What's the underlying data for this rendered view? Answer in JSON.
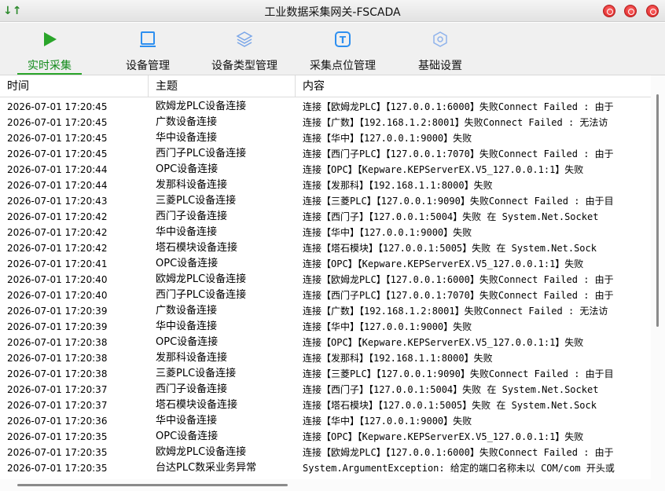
{
  "window": {
    "title": "工业数据采集网关-FSCADA",
    "app_icon": "sort-arrows-icon",
    "buttons": [
      "minimize",
      "maximize",
      "close"
    ],
    "button_color": "#e02424"
  },
  "toolbar": {
    "accent": "#2aa52a",
    "items": [
      {
        "label": "实时采集",
        "icon": "play-icon",
        "active": true
      },
      {
        "label": "设备管理",
        "icon": "monitor-icon",
        "active": false
      },
      {
        "label": "设备类型管理",
        "icon": "layers-icon",
        "active": false
      },
      {
        "label": "采集点位管理",
        "icon": "tag-icon",
        "active": false
      },
      {
        "label": "基础设置",
        "icon": "settings-icon",
        "active": false
      }
    ]
  },
  "grid": {
    "columns": [
      "时间",
      "主题",
      "内容"
    ],
    "rows": [
      [
        "2026-07-01 17:20:45",
        "欧姆龙PLC设备连接",
        "连接【欧姆龙PLC】【127.0.0.1:6000】失败Connect Failed : 由于"
      ],
      [
        "2026-07-01 17:20:45",
        "广数设备连接",
        "连接【广数】【192.168.1.2:8001】失败Connect Failed : 无法访"
      ],
      [
        "2026-07-01 17:20:45",
        "华中设备连接",
        "连接【华中】【127.0.0.1:9000】失败"
      ],
      [
        "2026-07-01 17:20:45",
        "西门子PLC设备连接",
        "连接【西门子PLC】【127.0.0.1:7070】失败Connect Failed : 由于"
      ],
      [
        "2026-07-01 17:20:44",
        "OPC设备连接",
        "连接【OPC】【Kepware.KEPServerEX.V5_127.0.0.1:1】失败"
      ],
      [
        "2026-07-01 17:20:44",
        "发那科设备连接",
        "连接【发那科】【192.168.1.1:8000】失败"
      ],
      [
        "2026-07-01 17:20:43",
        "三菱PLC设备连接",
        "连接【三菱PLC】【127.0.0.1:9090】失败Connect Failed : 由于目"
      ],
      [
        "2026-07-01 17:20:42",
        "西门子设备连接",
        "连接【西门子】【127.0.0.1:5004】失败   在 System.Net.Socket"
      ],
      [
        "2026-07-01 17:20:42",
        "华中设备连接",
        "连接【华中】【127.0.0.1:9000】失败"
      ],
      [
        "2026-07-01 17:20:42",
        "塔石模块设备连接",
        "连接【塔石模块】【127.0.0.1:5005】失败   在 System.Net.Sock"
      ],
      [
        "2026-07-01 17:20:41",
        "OPC设备连接",
        "连接【OPC】【Kepware.KEPServerEX.V5_127.0.0.1:1】失败"
      ],
      [
        "2026-07-01 17:20:40",
        "欧姆龙PLC设备连接",
        "连接【欧姆龙PLC】【127.0.0.1:6000】失败Connect Failed : 由于"
      ],
      [
        "2026-07-01 17:20:40",
        "西门子PLC设备连接",
        "连接【西门子PLC】【127.0.0.1:7070】失败Connect Failed : 由于"
      ],
      [
        "2026-07-01 17:20:39",
        "广数设备连接",
        "连接【广数】【192.168.1.2:8001】失败Connect Failed : 无法访"
      ],
      [
        "2026-07-01 17:20:39",
        "华中设备连接",
        "连接【华中】【127.0.0.1:9000】失败"
      ],
      [
        "2026-07-01 17:20:38",
        "OPC设备连接",
        "连接【OPC】【Kepware.KEPServerEX.V5_127.0.0.1:1】失败"
      ],
      [
        "2026-07-01 17:20:38",
        "发那科设备连接",
        "连接【发那科】【192.168.1.1:8000】失败"
      ],
      [
        "2026-07-01 17:20:38",
        "三菱PLC设备连接",
        "连接【三菱PLC】【127.0.0.1:9090】失败Connect Failed : 由于目"
      ],
      [
        "2026-07-01 17:20:37",
        "西门子设备连接",
        "连接【西门子】【127.0.0.1:5004】失败   在 System.Net.Socket"
      ],
      [
        "2026-07-01 17:20:37",
        "塔石模块设备连接",
        "连接【塔石模块】【127.0.0.1:5005】失败   在 System.Net.Sock"
      ],
      [
        "2026-07-01 17:20:36",
        "华中设备连接",
        "连接【华中】【127.0.0.1:9000】失败"
      ],
      [
        "2026-07-01 17:20:35",
        "OPC设备连接",
        "连接【OPC】【Kepware.KEPServerEX.V5_127.0.0.1:1】失败"
      ],
      [
        "2026-07-01 17:20:35",
        "欧姆龙PLC设备连接",
        "连接【欧姆龙PLC】【127.0.0.1:6000】失败Connect Failed : 由于"
      ],
      [
        "2026-07-01 17:20:35",
        "台达PLC数采业务异常",
        "System.ArgumentException: 给定的端口名称未以 COM/com 开头或"
      ]
    ]
  }
}
